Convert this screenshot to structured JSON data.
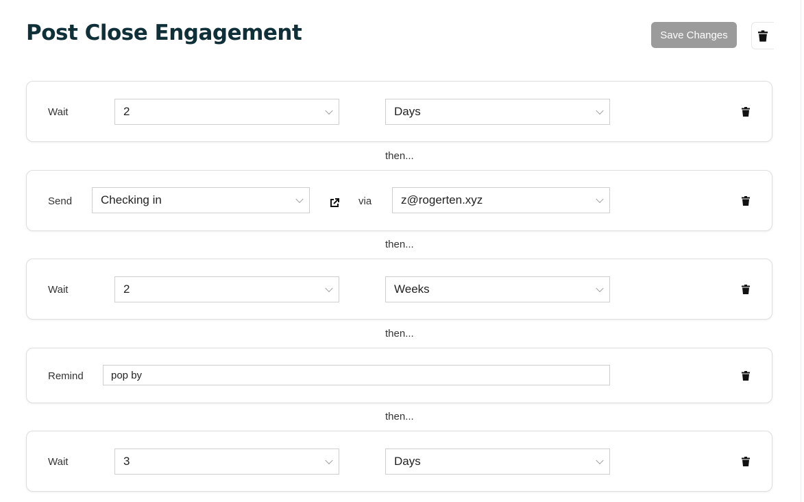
{
  "page": {
    "title": "Post Close Engagement",
    "save_label": "Save Changes",
    "delete_icon": "trash-icon"
  },
  "colors": {
    "title": "#0f3038",
    "save_button_bg": "#9b9b9b",
    "border": "#cfcfcf"
  },
  "separator_label": "then...",
  "steps": [
    {
      "type": "wait",
      "label": "Wait",
      "amount": "2",
      "unit": "Days"
    },
    {
      "type": "send",
      "label": "Send",
      "template": "Checking in",
      "via_label": "via",
      "via": "z@rogerten.xyz"
    },
    {
      "type": "wait",
      "label": "Wait",
      "amount": "2",
      "unit": "Weeks"
    },
    {
      "type": "remind",
      "label": "Remind",
      "text": "pop by"
    },
    {
      "type": "wait",
      "label": "Wait",
      "amount": "3",
      "unit": "Days"
    }
  ]
}
